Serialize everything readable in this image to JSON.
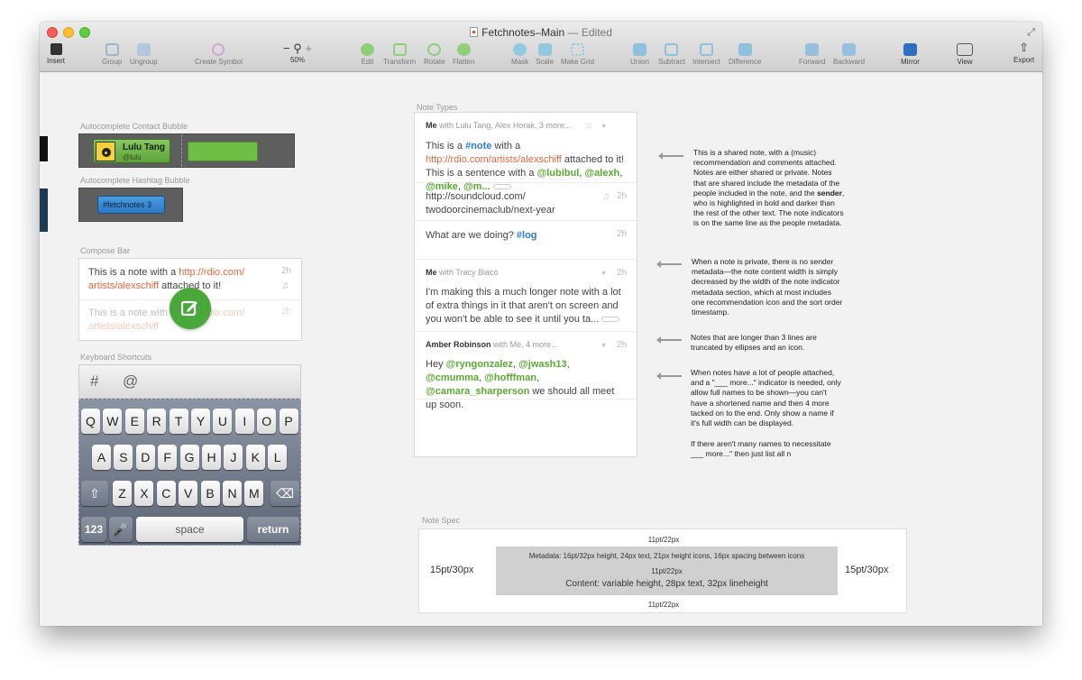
{
  "window": {
    "title": "Fetchnotes–Main",
    "edited": "— Edited"
  },
  "toolbar": {
    "insert": "Insert",
    "group": "Group",
    "ungroup": "Ungroup",
    "create_symbol": "Create Symbol",
    "zoom_minus": "−",
    "zoom_plus": "+",
    "zoom_level": "50%",
    "edit": "Edit",
    "transform": "Transform",
    "rotate": "Rotate",
    "flatten": "Flatten",
    "mask": "Mask",
    "scale": "Scale",
    "make_grid": "Make Grid",
    "union": "Union",
    "subtract": "Subtract",
    "intersect": "Intersect",
    "difference": "Difference",
    "forward": "Forward",
    "backward": "Backward",
    "mirror": "Mirror",
    "view": "View",
    "export": "Export"
  },
  "sections": {
    "contact_bubble": "Autocomplete Contact Bubble",
    "hashtag_bubble": "Autocomplete Hashtag Bubble",
    "compose_bar": "Compose Bar",
    "keyboard": "Keyboard Shortcuts",
    "note_types": "Note Types",
    "note_spec": "Note Spec"
  },
  "contact": {
    "name": "Lulu Tang",
    "handle": "@lulu"
  },
  "hashtag": {
    "tag": "#fetchnotes",
    "count": "3"
  },
  "compose": {
    "row1_text": "This is a note with a ",
    "row1_link1": "http://rdio.com/",
    "row1_link2": "artists/alexschiff",
    "row1_tail": " attached to it!",
    "row1_time": "2h",
    "row2_text": "This is a note with a ",
    "row2_link": "http://rdio.com/",
    "row2_link2": "artists/alexschiff",
    "row2_time": "2h"
  },
  "keyboard": {
    "shortcut1": "#",
    "shortcut2": "@",
    "row1": [
      "Q",
      "W",
      "E",
      "R",
      "T",
      "Y",
      "U",
      "I",
      "O",
      "P"
    ],
    "row2": [
      "A",
      "S",
      "D",
      "F",
      "G",
      "H",
      "J",
      "K",
      "L"
    ],
    "row3": [
      "Z",
      "X",
      "C",
      "V",
      "B",
      "N",
      "M"
    ],
    "num": "123",
    "space": "space",
    "return": "return"
  },
  "notes": [
    {
      "sender": "Me",
      "with": " with Lulu Tang, Alex Horak, 3 more...",
      "p1": "This is a ",
      "tag": "#note",
      "p2": " with a ",
      "link": "http://rdio.com/artists/alexschiff",
      "p3": " attached to it! This is a sentence with a ",
      "m1": "@lubibul",
      "m2": "@alexh",
      "m3": "@mike",
      "m4": "@m..."
    },
    {
      "link1": "http://soundcloud.com/",
      "link2": "twodoorcinemaclub/next-year",
      "time": "2h"
    },
    {
      "text": "What are we doing? ",
      "tag": "#log",
      "time": "2h"
    },
    {
      "sender": "Me",
      "with": " with Tracy Biaco",
      "time": "2h",
      "body": "I'm making this a much longer note with a lot of extra things in it that aren't on screen and you won't be able to see it until you ta..."
    },
    {
      "sender": "Amber Robinson",
      "with": " with Me, 4 more...",
      "time": "2h",
      "p1": "Hey ",
      "m1": "@ryngonzalez",
      "m2": "@jwash13",
      "m3": "@cmumma",
      "m4": "@hofffman",
      "m5": "@camara_sharperson",
      "p2": " we should all meet up soon."
    }
  ],
  "annotations": {
    "a1_1": "This is a shared note, with a (music) recommendation and comments attached. Notes are either shared or private. Notes that are shared include the metadata of the people included in the note, and the ",
    "a1_bold": "sender",
    "a1_2": ", who is highlighted in bold and darker than the rest of the other text. The note indicators is on the same line as the people metadata.",
    "a2": "When a note is private, there is no sender metadata—the note content width is simply decreased by the width of the note indicator metadata section, which at most includes one recommendation icon and the sort order timestamp.",
    "a3": "Notes that are longer than 3 lines are truncated by ellipses and an icon.",
    "a4": "When notes have a lot of people attached, and a \"___ more...\" indicator is needed, only allow full names to be shown—you can't have a shortened name and then 4 more tacked on to the end. Only show a name if it's full width can be displayed.",
    "a5": "If there aren't many names to necessitate ___ more...\" then just list all n"
  },
  "spec": {
    "top": "11pt/22px",
    "left": "15pt/30px",
    "right": "15pt/30px",
    "metadata": "Metadata: 16pt/32px height, 24px text, 21px height icons, 16px spacing between icons",
    "mid": "11pt/22px",
    "content": "Content: variable height, 28px text, 32px lineheight",
    "bottom": "11pt/22px"
  }
}
